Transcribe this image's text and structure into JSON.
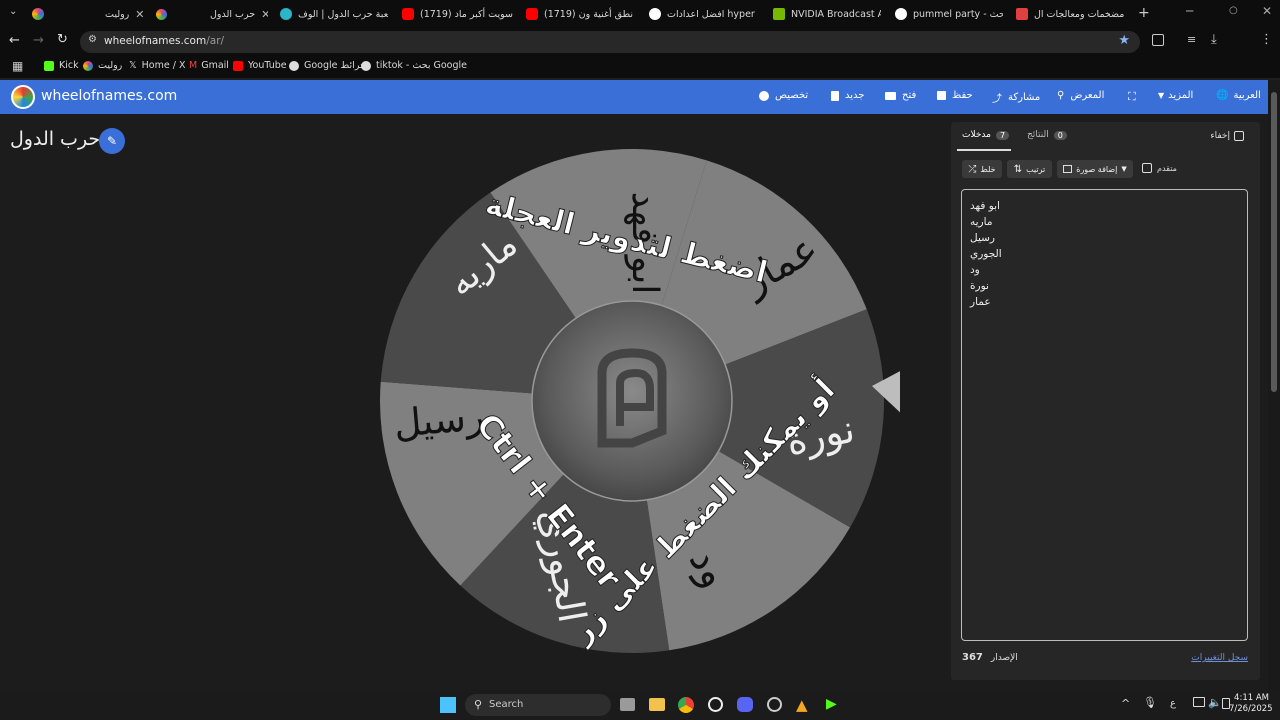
{
  "browser": {
    "tabs": [
      {
        "label": "رولیت",
        "color": "#e0457b"
      },
      {
        "label": "حرب الدول",
        "color": "#e0457b"
      },
      {
        "label": "لعبة حرب الدول | الوف",
        "color": "#2bb5c6"
      },
      {
        "label": "(1719) سويت أكبر ماد",
        "color": "#ff0000"
      },
      {
        "label": "(1719) نطق أغنية ون",
        "color": "#ff0000"
      },
      {
        "label": "افضل اعدادات hyper x",
        "color": "#888888"
      },
      {
        "label": "NVIDIA Broadcast A",
        "color": "#76b900"
      },
      {
        "label": "pummel party - بحث",
        "color": "#ffffff"
      },
      {
        "label": "مضخمات ومعالجات ال",
        "color": "#e04040"
      }
    ],
    "url_host": "wheelofnames.com",
    "url_path": "/ar/",
    "bookmarks": [
      {
        "label": "Kick",
        "color": "#53fc18"
      },
      {
        "label": "رولیت",
        "color": "#e0457b"
      },
      {
        "label": "Home / X",
        "color": "#dddddd"
      },
      {
        "label": "Gmail",
        "color": "#ea4335"
      },
      {
        "label": "YouTube",
        "color": "#ff0000"
      },
      {
        "label": "Google خرائط",
        "color": "#cccccc"
      },
      {
        "label": "tiktok - بحث Google",
        "color": "#cccccc"
      }
    ]
  },
  "site": {
    "brand": "wheelofnames.com",
    "nav": {
      "language": "العربية",
      "more": "المزيد",
      "gallery": "المعرض",
      "share": "مشاركة",
      "save": "حفظ",
      "open": "فتح",
      "new": "جديد",
      "customize": "تخصيص"
    },
    "wheel_title": "حرب الدول",
    "wheel": {
      "instruction": "اضغط لتدوير العجلة",
      "hint_line1": "أو يمكنك الضغط على زر",
      "hint_line2": "Ctrl + Enter",
      "slice_names": [
        "عمار",
        "نورة",
        "ود",
        "الجوري",
        "رسيل",
        "ماريه",
        "ابو فهد"
      ]
    },
    "panel": {
      "tabs": {
        "entries_label": "مدخلات",
        "entries_count": "7",
        "results_label": "النتائج",
        "results_count": "0"
      },
      "hide_label": "إخفاء",
      "shuffle": "خلط",
      "sort": "ترتيب",
      "add_image": "إضافة صورة",
      "advanced": "متقدم",
      "entries": [
        "ابو فهد",
        "ماريه",
        "رسيل",
        "الجوري",
        "ود",
        "نورة",
        "عمار"
      ],
      "version_label": "الإصدار",
      "version": "367",
      "changelog": "سجل التغييرات"
    }
  },
  "taskbar": {
    "search_placeholder": "Search",
    "time": "4:11 AM",
    "date": "7/26/2025",
    "lang": "ع"
  },
  "colors": {
    "header_bg": "#3b6fd8",
    "slice_light": "#808080",
    "slice_dark": "#4a4a4a"
  }
}
